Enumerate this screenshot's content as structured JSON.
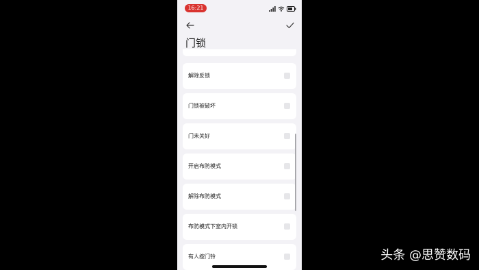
{
  "status_bar": {
    "time": "16:21"
  },
  "page": {
    "title": "门锁"
  },
  "options": [
    {
      "label": "解除反锁"
    },
    {
      "label": "门锁被破坏"
    },
    {
      "label": "门未关好"
    },
    {
      "label": "开启布防模式"
    },
    {
      "label": "解除布防模式"
    },
    {
      "label": "布防模式下室内开锁"
    },
    {
      "label": "有人按门铃"
    }
  ],
  "watermark": "头条 @思赞数码"
}
